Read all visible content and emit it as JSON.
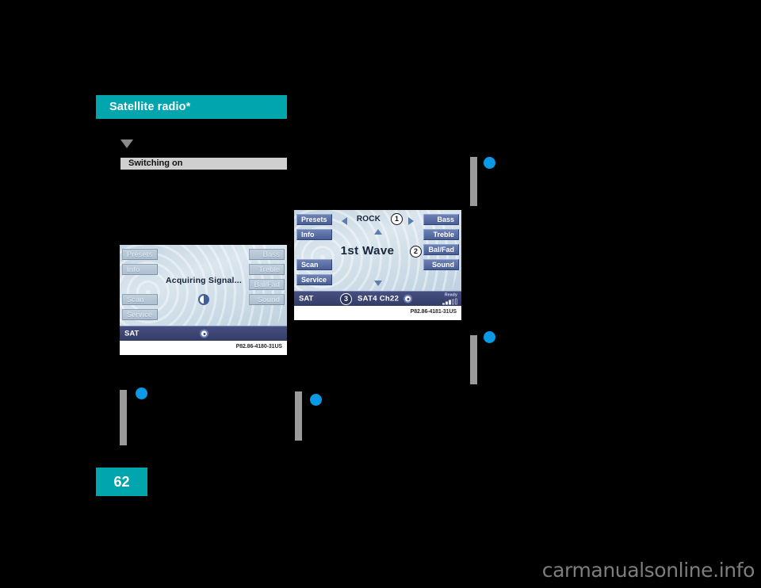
{
  "page": {
    "chapter_title": "Satellite radio*",
    "section_heading": "Switching on",
    "page_number": "62",
    "watermark": "carmanualsonline.info"
  },
  "figure_acquiring": {
    "caption": "P82.86-4180-31US",
    "center_text": "Acquiring Signal...",
    "status_label": "SAT",
    "left_buttons": [
      {
        "label": "Presets",
        "state": "inactive"
      },
      {
        "label": "Info",
        "state": "inactive"
      },
      {
        "label": "Scan",
        "state": "inactive"
      },
      {
        "label": "Service",
        "state": "inactive"
      }
    ],
    "right_buttons": [
      {
        "label": "Bass",
        "state": "inactive"
      },
      {
        "label": "Treble",
        "state": "inactive"
      },
      {
        "label": "Bal/Fad",
        "state": "inactive"
      },
      {
        "label": "Sound",
        "state": "inactive"
      }
    ]
  },
  "figure_playing": {
    "caption": "P82.86-4181-31US",
    "category": "ROCK",
    "track_title": "1st Wave",
    "status_label": "SAT",
    "channel_info": "SAT4  Ch22",
    "signal_ready_label": "Ready",
    "signal_bars_filled": 3,
    "signal_bars_total": 5,
    "left_buttons": [
      {
        "label": "Presets",
        "state": "active"
      },
      {
        "label": "Info",
        "state": "active"
      },
      {
        "label": "Scan",
        "state": "active"
      },
      {
        "label": "Service",
        "state": "active"
      }
    ],
    "right_buttons": [
      {
        "label": "Bass",
        "state": "active"
      },
      {
        "label": "Treble",
        "state": "active"
      },
      {
        "label": "Bal/Fad",
        "state": "active"
      },
      {
        "label": "Sound",
        "state": "active"
      }
    ],
    "callouts": [
      {
        "number": "1",
        "target": "category"
      },
      {
        "number": "2",
        "target": "track-title"
      },
      {
        "number": "3",
        "target": "channel-info"
      }
    ]
  },
  "colors": {
    "brand_teal": "#00A5AD",
    "marker_blue": "#0a9ae5",
    "subhead_grey": "#cfcfcf"
  }
}
